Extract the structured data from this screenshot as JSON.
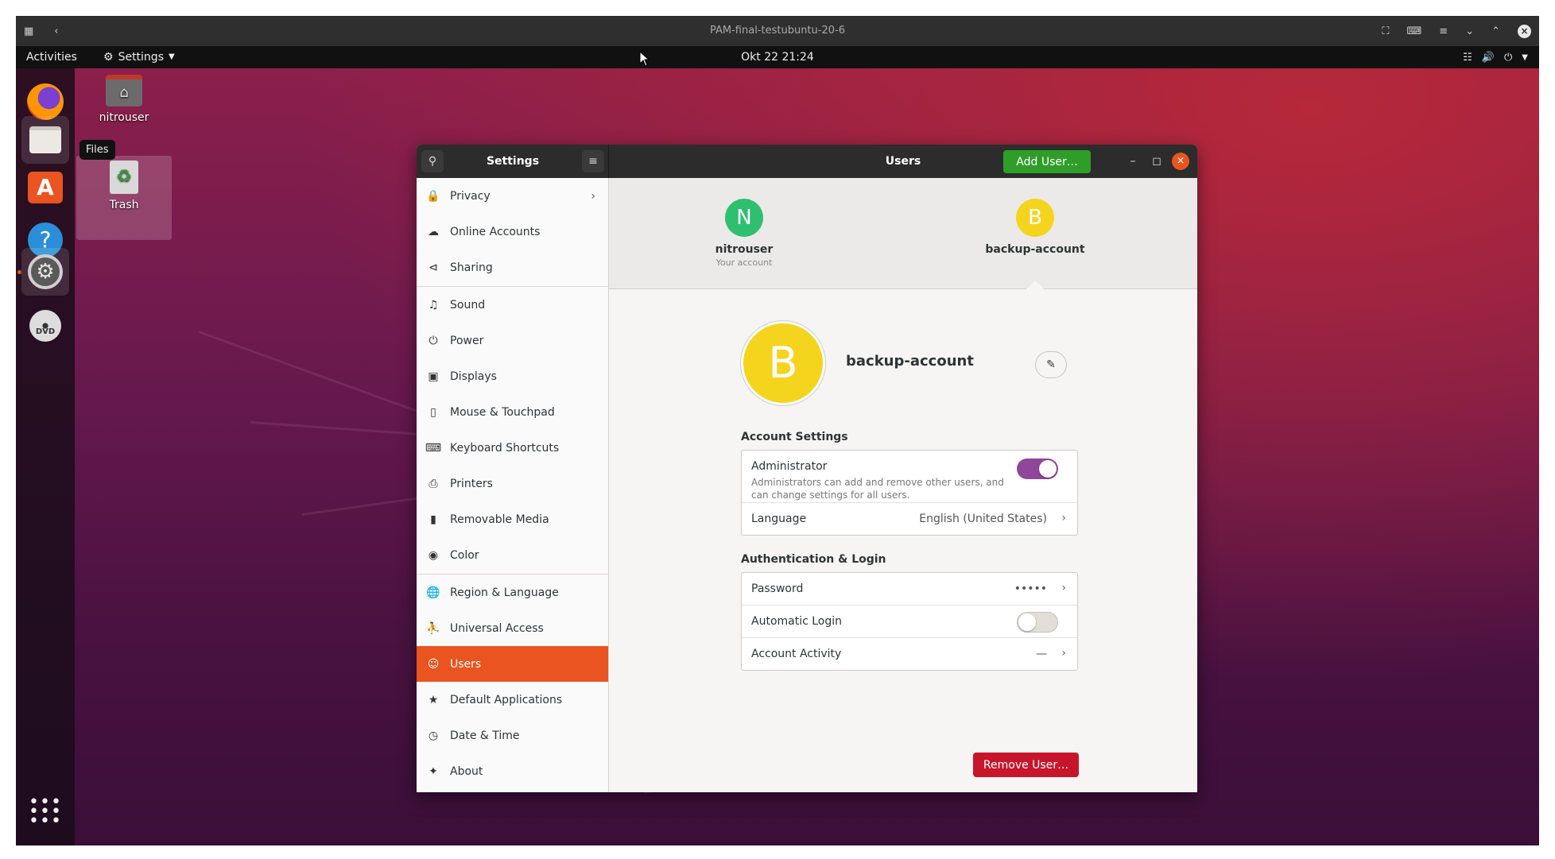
{
  "vm": {
    "title": "PAM-final-testubuntu-20-6"
  },
  "topbar": {
    "activities": "Activities",
    "app_menu": "Settings",
    "clock": "Okt 22  21:24"
  },
  "desktop": {
    "icons": [
      {
        "label": "nitrouser",
        "icon": "home-folder-icon"
      },
      {
        "label": "Trash",
        "icon": "trash-icon"
      }
    ],
    "dock_tooltip": "Files",
    "dock_items": [
      "firefox-icon",
      "files-icon",
      "software-icon",
      "help-icon",
      "settings-icon",
      "dvd-icon",
      "app-grid-icon"
    ]
  },
  "window": {
    "sidebar_title": "Settings",
    "title": "Users",
    "add_user": "Add User…",
    "sidebar": [
      {
        "label": "Privacy",
        "icon": "lock-icon"
      },
      {
        "label": "Online Accounts",
        "icon": "cloud-icon"
      },
      {
        "label": "Sharing",
        "icon": "share-icon"
      },
      {
        "label": "Sound",
        "icon": "music-note-icon"
      },
      {
        "label": "Power",
        "icon": "power-icon"
      },
      {
        "label": "Displays",
        "icon": "display-icon"
      },
      {
        "label": "Mouse & Touchpad",
        "icon": "mouse-icon"
      },
      {
        "label": "Keyboard Shortcuts",
        "icon": "keyboard-icon"
      },
      {
        "label": "Printers",
        "icon": "printer-icon"
      },
      {
        "label": "Removable Media",
        "icon": "usb-icon"
      },
      {
        "label": "Color",
        "icon": "color-icon"
      },
      {
        "label": "Region & Language",
        "icon": "globe-icon"
      },
      {
        "label": "Universal Access",
        "icon": "accessibility-icon"
      },
      {
        "label": "Users",
        "icon": "users-icon"
      },
      {
        "label": "Default Applications",
        "icon": "star-icon"
      },
      {
        "label": "Date & Time",
        "icon": "clock-icon"
      },
      {
        "label": "About",
        "icon": "about-icon"
      }
    ],
    "selected": "Users",
    "users": [
      {
        "initial": "N",
        "name": "nitrouser",
        "sub": "Your account",
        "color": "#2fbf71"
      },
      {
        "initial": "B",
        "name": "backup-account",
        "sub": "",
        "color": "#f5d41e"
      }
    ],
    "detail": {
      "initial": "B",
      "name": "backup-account",
      "account_settings": "Account Settings",
      "administrator": "Administrator",
      "administrator_desc": "Administrators can add and remove other users, and can change settings for all users.",
      "administrator_on": true,
      "language_label": "Language",
      "language_value": "English (United States)",
      "auth_heading": "Authentication & Login",
      "password_label": "Password",
      "password_value": "•••••",
      "autologin_label": "Automatic Login",
      "autologin_on": false,
      "activity_label": "Account Activity",
      "activity_value": "—",
      "remove_user": "Remove User…"
    }
  },
  "colors": {
    "accent": "#e95420",
    "toggle_on": "#8f4799",
    "add_green": "#2f9e28",
    "remove_red": "#c7162b"
  }
}
